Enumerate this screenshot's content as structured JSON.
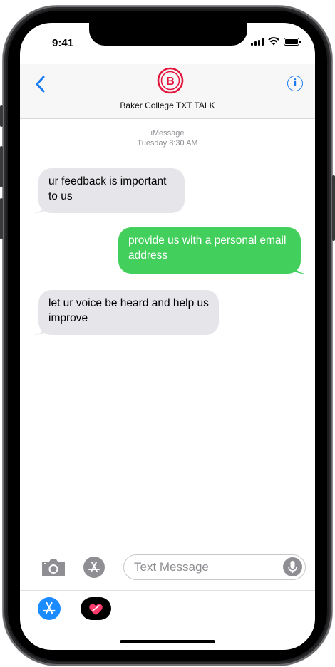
{
  "status_bar": {
    "time": "9:41"
  },
  "header": {
    "contact_name": "Baker College TXT TALK",
    "logo_letter": "B",
    "info_label": "i"
  },
  "thread": {
    "service": "iMessage",
    "timestamp": "Tuesday  8:30 AM",
    "messages": [
      {
        "direction": "received",
        "text": "ur feedback is important to us"
      },
      {
        "direction": "sent",
        "text": "provide us with a personal email address"
      },
      {
        "direction": "received",
        "text": "let ur voice be heard and help us improve"
      }
    ]
  },
  "composer": {
    "placeholder": "Text Message",
    "value": ""
  },
  "colors": {
    "accent": "#1a7cf5",
    "sent_bubble": "#43cf5c",
    "received_bubble": "#e5e5ea",
    "logo_red": "#e3173e"
  },
  "icons": [
    "back-chevron-icon",
    "info-icon",
    "camera-icon",
    "app-store-icon",
    "microphone-icon",
    "digital-touch-icon"
  ]
}
